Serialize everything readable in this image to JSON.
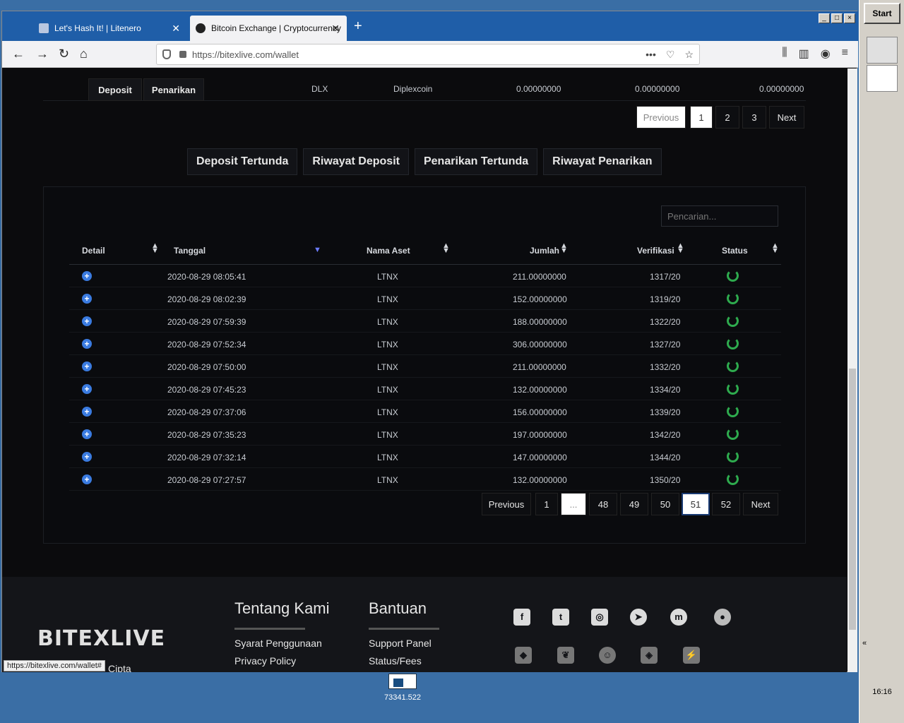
{
  "browser": {
    "tabs": [
      {
        "title": "Let's Hash It! | Litenero"
      },
      {
        "title": "Bitcoin Exchange | Cryptocurrency"
      }
    ],
    "url": "https://bitexlive.com/wallet",
    "status_link": "https://bitexlive.com/wallet#"
  },
  "top_table": {
    "row": {
      "btn_deposit": "Deposit",
      "btn_withdraw": "Penarikan",
      "symbol": "DLX",
      "name": "Diplexcoin",
      "v1": "0.00000000",
      "v2": "0.00000000",
      "v3": "0.00000000"
    },
    "pagination": {
      "prev": "Previous",
      "pages": [
        "1",
        "2",
        "3"
      ],
      "next": "Next"
    }
  },
  "history_tabs": [
    "Deposit Tertunda",
    "Riwayat Deposit",
    "Penarikan Tertunda",
    "Riwayat Penarikan"
  ],
  "history": {
    "search_placeholder": "Pencarian...",
    "headers": {
      "detail": "Detail",
      "date": "Tanggal",
      "asset": "Nama Aset",
      "amount": "Jumlah",
      "verify": "Verifikasi",
      "status": "Status"
    },
    "rows": [
      {
        "date": "2020-08-29 08:05:41",
        "asset": "LTNX",
        "amount": "211.00000000",
        "verify": "1317/20"
      },
      {
        "date": "2020-08-29 08:02:39",
        "asset": "LTNX",
        "amount": "152.00000000",
        "verify": "1319/20"
      },
      {
        "date": "2020-08-29 07:59:39",
        "asset": "LTNX",
        "amount": "188.00000000",
        "verify": "1322/20"
      },
      {
        "date": "2020-08-29 07:52:34",
        "asset": "LTNX",
        "amount": "306.00000000",
        "verify": "1327/20"
      },
      {
        "date": "2020-08-29 07:50:00",
        "asset": "LTNX",
        "amount": "211.00000000",
        "verify": "1332/20"
      },
      {
        "date": "2020-08-29 07:45:23",
        "asset": "LTNX",
        "amount": "132.00000000",
        "verify": "1334/20"
      },
      {
        "date": "2020-08-29 07:37:06",
        "asset": "LTNX",
        "amount": "156.00000000",
        "verify": "1339/20"
      },
      {
        "date": "2020-08-29 07:35:23",
        "asset": "LTNX",
        "amount": "197.00000000",
        "verify": "1342/20"
      },
      {
        "date": "2020-08-29 07:32:14",
        "asset": "LTNX",
        "amount": "147.00000000",
        "verify": "1344/20"
      },
      {
        "date": "2020-08-29 07:27:57",
        "asset": "LTNX",
        "amount": "132.00000000",
        "verify": "1350/20"
      }
    ],
    "pagination": {
      "prev": "Previous",
      "first": "1",
      "ellipsis": "...",
      "p48": "48",
      "p49": "49",
      "p50": "50",
      "p51": "51",
      "p52": "52",
      "next": "Next"
    }
  },
  "footer": {
    "logo": "BITEXLIVE",
    "about": {
      "title": "Tentang Kami",
      "links": [
        "Syarat Penggunaan",
        "Privacy Policy"
      ]
    },
    "help": {
      "title": "Bantuan",
      "links": [
        "Support Panel",
        "Status/Fees"
      ]
    },
    "partial_text": "Cipta"
  },
  "desktop": {
    "icon_label": "73341.522"
  },
  "taskbar": {
    "start": "Start",
    "clock": "16:16"
  }
}
